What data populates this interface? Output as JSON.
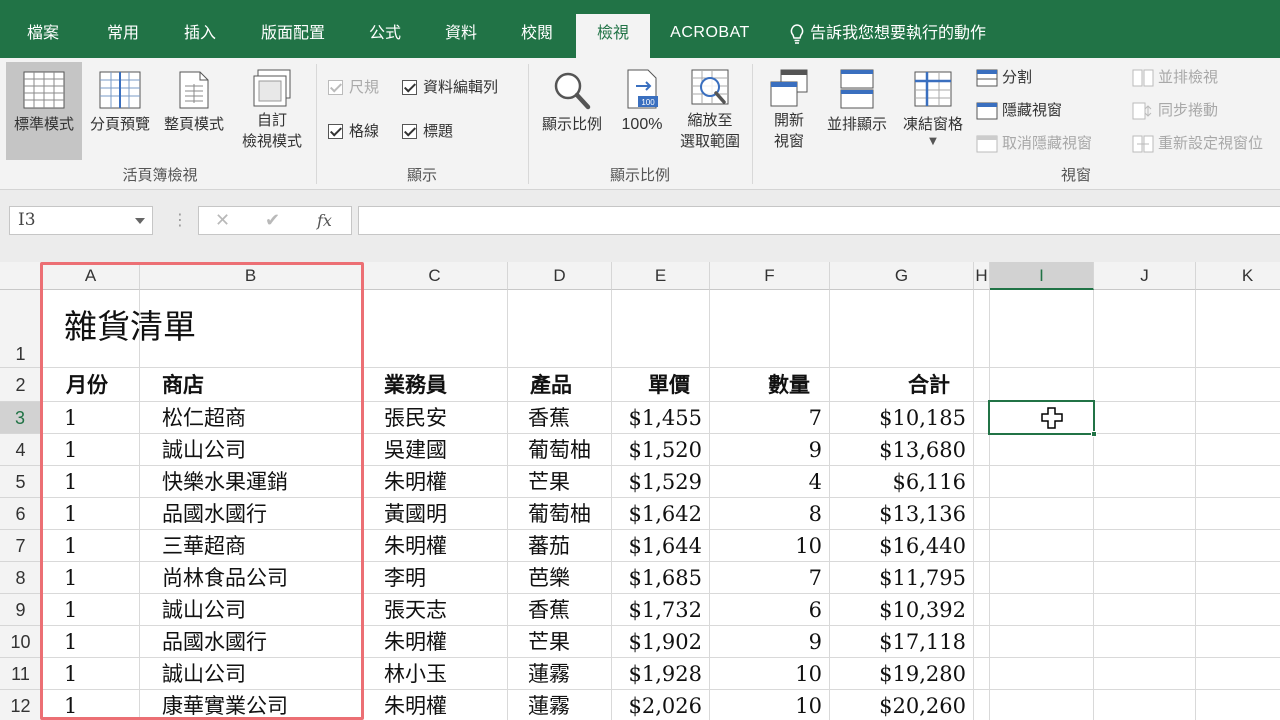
{
  "tabs": [
    "檔案",
    "常用",
    "插入",
    "版面配置",
    "公式",
    "資料",
    "校閱",
    "檢視",
    "ACROBAT"
  ],
  "tell_me": "告訴我您想要執行的動作",
  "ribbon": {
    "workbook_views": {
      "buttons": [
        "標準模式",
        "分頁預覽",
        "整頁模式"
      ],
      "custom_line1": "自訂",
      "custom_line2": "檢視模式",
      "label": "活頁簿檢視"
    },
    "show": {
      "ruler": "尺規",
      "formula_bar": "資料編輯列",
      "gridlines": "格線",
      "headings": "標題",
      "label": "顯示"
    },
    "zoom": {
      "zoom": "顯示比例",
      "hundred": "100%",
      "hundred_badge": "100",
      "to_sel_line1": "縮放至",
      "to_sel_line2": "選取範圍",
      "label": "顯示比例"
    },
    "window": {
      "new_line1": "開新",
      "new_line2": "視窗",
      "arrange": "並排顯示",
      "freeze": "凍結窗格",
      "split": "分割",
      "hide": "隱藏視窗",
      "unhide": "取消隱藏視窗",
      "side_by_side": "並排檢視",
      "sync_scroll": "同步捲動",
      "reset_pos": "重新設定視窗位",
      "label": "視窗"
    }
  },
  "name_box": "I3",
  "formula_symbols": {
    "cancel": "✕",
    "enter": "✔",
    "fx": "fx",
    "dots": "⋮"
  },
  "columns": [
    "A",
    "B",
    "C",
    "D",
    "E",
    "F",
    "G",
    "H",
    "I",
    "J",
    "K"
  ],
  "rows": [
    "1",
    "2",
    "3",
    "4",
    "5",
    "6",
    "7",
    "8",
    "9",
    "10",
    "11",
    "12"
  ],
  "sheet": {
    "title": "雜貨清單",
    "headers": [
      "月份",
      "商店",
      "業務員",
      "產品",
      "單價",
      "數量",
      "合計"
    ],
    "data": [
      [
        "1",
        "松仁超商",
        "張民安",
        "香蕉",
        "$1,455",
        "7",
        "$10,185"
      ],
      [
        "1",
        "誠山公司",
        "吳建國",
        "葡萄柚",
        "$1,520",
        "9",
        "$13,680"
      ],
      [
        "1",
        "快樂水果運銷",
        "朱明權",
        "芒果",
        "$1,529",
        "4",
        "$6,116"
      ],
      [
        "1",
        "品國水國行",
        "黃國明",
        "葡萄柚",
        "$1,642",
        "8",
        "$13,136"
      ],
      [
        "1",
        "三華超商",
        "朱明權",
        "蕃茄",
        "$1,644",
        "10",
        "$16,440"
      ],
      [
        "1",
        "尚林食品公司",
        "李明",
        "芭樂",
        "$1,685",
        "7",
        "$11,795"
      ],
      [
        "1",
        "誠山公司",
        "張天志",
        "香蕉",
        "$1,732",
        "6",
        "$10,392"
      ],
      [
        "1",
        "品國水國行",
        "朱明權",
        "芒果",
        "$1,902",
        "9",
        "$17,118"
      ],
      [
        "1",
        "誠山公司",
        "林小玉",
        "蓮霧",
        "$1,928",
        "10",
        "$19,280"
      ],
      [
        "1",
        "康華實業公司",
        "朱明權",
        "蓮霧",
        "$2,026",
        "10",
        "$20,260"
      ]
    ]
  },
  "colors": {
    "excel_green": "#217346",
    "highlight": "#ec6f74"
  }
}
